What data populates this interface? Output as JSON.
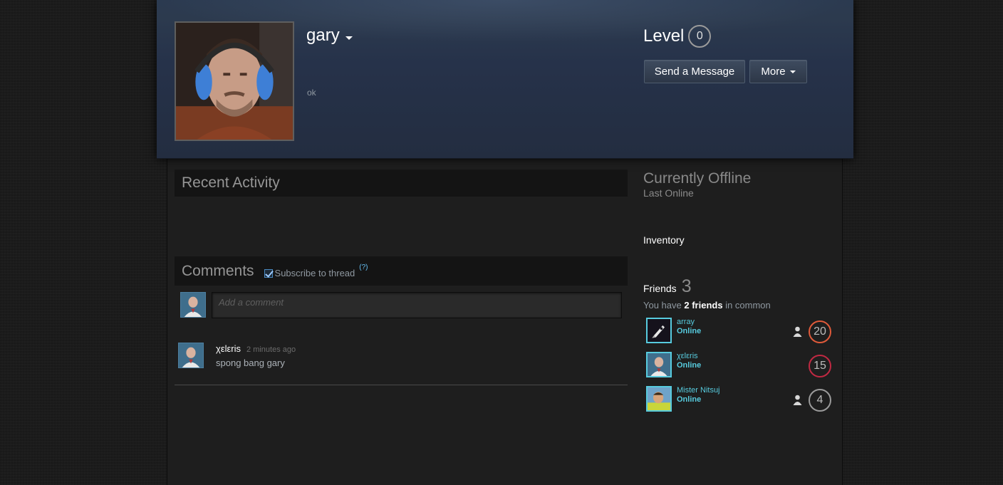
{
  "profile": {
    "persona_name": "gary",
    "summary": "ok",
    "level_label": "Level",
    "level": "0",
    "send_message": "Send a Message",
    "more": "More"
  },
  "sections": {
    "recent_activity": "Recent Activity",
    "comments": "Comments",
    "subscribe": "Subscribe to thread",
    "help": "(?)"
  },
  "comment_input": {
    "placeholder": "Add a comment"
  },
  "comment": {
    "author": "χεlεris",
    "time": "2 minutes ago",
    "text": "spong bang gary"
  },
  "sidebar": {
    "status": "Currently Offline",
    "last_online": "Last Online",
    "inventory": "Inventory",
    "friends_label": "Friends",
    "friends_count": "3",
    "common_prefix": "You have",
    "common_count": "2 friends",
    "common_suffix": "in common",
    "friends": [
      {
        "name": "array",
        "status": "Online",
        "level": "20",
        "in_common": true
      },
      {
        "name": "χεlεris",
        "status": "Online",
        "level": "15",
        "in_common": false
      },
      {
        "name": "Mister Nitsuj",
        "status": "Online",
        "level": "4",
        "in_common": true
      }
    ]
  },
  "colors": {
    "accent_online": "#57cbde",
    "header_bg": "#26324a",
    "page_bg": "#1b1b1b"
  }
}
